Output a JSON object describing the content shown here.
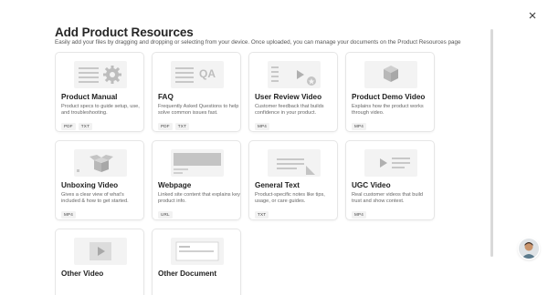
{
  "dialog": {
    "title": "Add Product Resources",
    "subtitle": "Easily add your files by dragging and dropping or selecting from your device. Once uploaded, you can manage your documents on the Product Resources page",
    "close_icon": "close-icon"
  },
  "cards": [
    {
      "title": "Product Manual",
      "desc": "Product specs to guide setup, use, and troubleshooting.",
      "tags": [
        "PDF",
        "TXT"
      ],
      "thumb": "manual"
    },
    {
      "title": "FAQ",
      "desc": "Frequently Asked Questions to help solve common issues fast.",
      "tags": [
        "PDF",
        "TXT"
      ],
      "thumb": "faq",
      "thumb_text": "QA"
    },
    {
      "title": "User Review Video",
      "desc": "Customer feedback that builds confidence in your product.",
      "tags": [
        "MP4"
      ],
      "thumb": "review"
    },
    {
      "title": "Product Demo Video",
      "desc": "Explains how the product works through video.",
      "tags": [
        "MP4"
      ],
      "thumb": "demo"
    },
    {
      "title": "Unboxing Video",
      "desc": "Gives a clear view of what's included & how to get started.",
      "tags": [
        "MP4"
      ],
      "thumb": "unboxing"
    },
    {
      "title": "Webpage",
      "desc": "Linked site content that explains key product info.",
      "tags": [
        "URL"
      ],
      "thumb": "webpage"
    },
    {
      "title": "General Text",
      "desc": "Product-specific notes like tips, usage, or care guides.",
      "tags": [
        "TXT"
      ],
      "thumb": "text"
    },
    {
      "title": "UGC Video",
      "desc": "Real customer videos that build trust and show context.",
      "tags": [
        "MP4"
      ],
      "thumb": "ugc"
    },
    {
      "title": "Other Video",
      "desc": "",
      "tags": [],
      "thumb": "othervideo"
    },
    {
      "title": "Other Document",
      "desc": "",
      "tags": [],
      "thumb": "otherdoc"
    }
  ],
  "colors": {
    "thumb_bg": "#f3f3f3",
    "thumb_shape": "#bfbfbf",
    "card_border": "#e6e6e6"
  },
  "avatar": "user-avatar"
}
